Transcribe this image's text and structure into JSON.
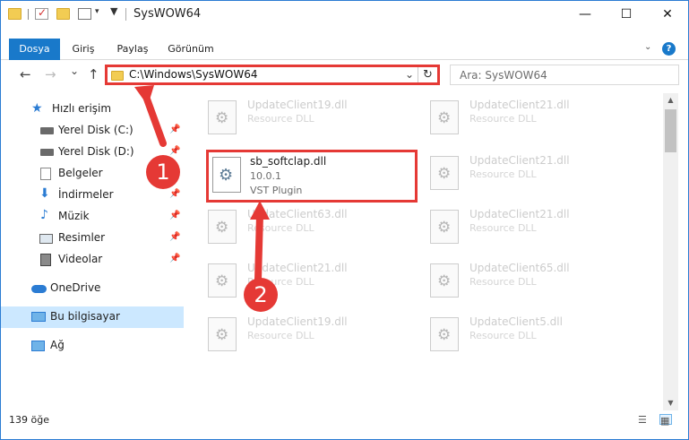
{
  "window": {
    "title": "SysWOW64"
  },
  "caption": {
    "minimize": "—",
    "maximize": "☐",
    "close": "✕"
  },
  "ribbon": {
    "tabs": [
      "Dosya",
      "Giriş",
      "Paylaş",
      "Görünüm"
    ]
  },
  "nav": {
    "back": "←",
    "forward": "→",
    "recent": "⌄",
    "up": "↑",
    "address": "C:\\Windows\\SysWOW64",
    "search_placeholder": "Ara: SysWOW64"
  },
  "sidebar": {
    "items": [
      {
        "label": "Hızlı erişim",
        "icon": "star-icon"
      },
      {
        "label": "Yerel Disk (C:)",
        "icon": "drive-icon",
        "pinned": true
      },
      {
        "label": "Yerel Disk (D:)",
        "icon": "drive-icon",
        "pinned": true
      },
      {
        "label": "Belgeler",
        "icon": "documents-icon",
        "pinned": true
      },
      {
        "label": "İndirmeler",
        "icon": "download-icon",
        "pinned": true
      },
      {
        "label": "Müzik",
        "icon": "music-icon",
        "pinned": true
      },
      {
        "label": "Resimler",
        "icon": "pictures-icon",
        "pinned": true
      },
      {
        "label": "Videolar",
        "icon": "video-icon",
        "pinned": true
      },
      {
        "label": "OneDrive",
        "icon": "cloud-icon"
      },
      {
        "label": "Bu bilgisayar",
        "icon": "computer-icon",
        "selected": true
      },
      {
        "label": "Ağ",
        "icon": "network-icon"
      }
    ]
  },
  "files": {
    "highlighted": {
      "name": "sb_softclap.dll",
      "version": "10.0.1",
      "type": "VST Plugin"
    },
    "left_column": [
      {
        "name": "UpdateClient19.dll",
        "type": "Resource DLL"
      },
      {
        "name": "UpdateClient63.dll",
        "type": "Resource DLL"
      },
      {
        "name": "UpdateClient21.dll",
        "type": "Resource DLL"
      },
      {
        "name": "UpdateClient19.dll",
        "type": "Resource DLL"
      }
    ],
    "right_column": [
      {
        "name": "UpdateClient21.dll",
        "type": "Resource DLL"
      },
      {
        "name": "UpdateClient21.dll",
        "type": "Resource DLL"
      },
      {
        "name": "UpdateClient21.dll",
        "type": "Resource DLL"
      },
      {
        "name": "UpdateClient65.dll",
        "type": "Resource DLL"
      },
      {
        "name": "UpdateClient5.dll",
        "type": "Resource DLL"
      }
    ]
  },
  "status": {
    "count": "139 öğe"
  },
  "callouts": {
    "one": "1",
    "two": "2"
  },
  "colors": {
    "accent": "#1979ca",
    "callout": "#e53935"
  }
}
